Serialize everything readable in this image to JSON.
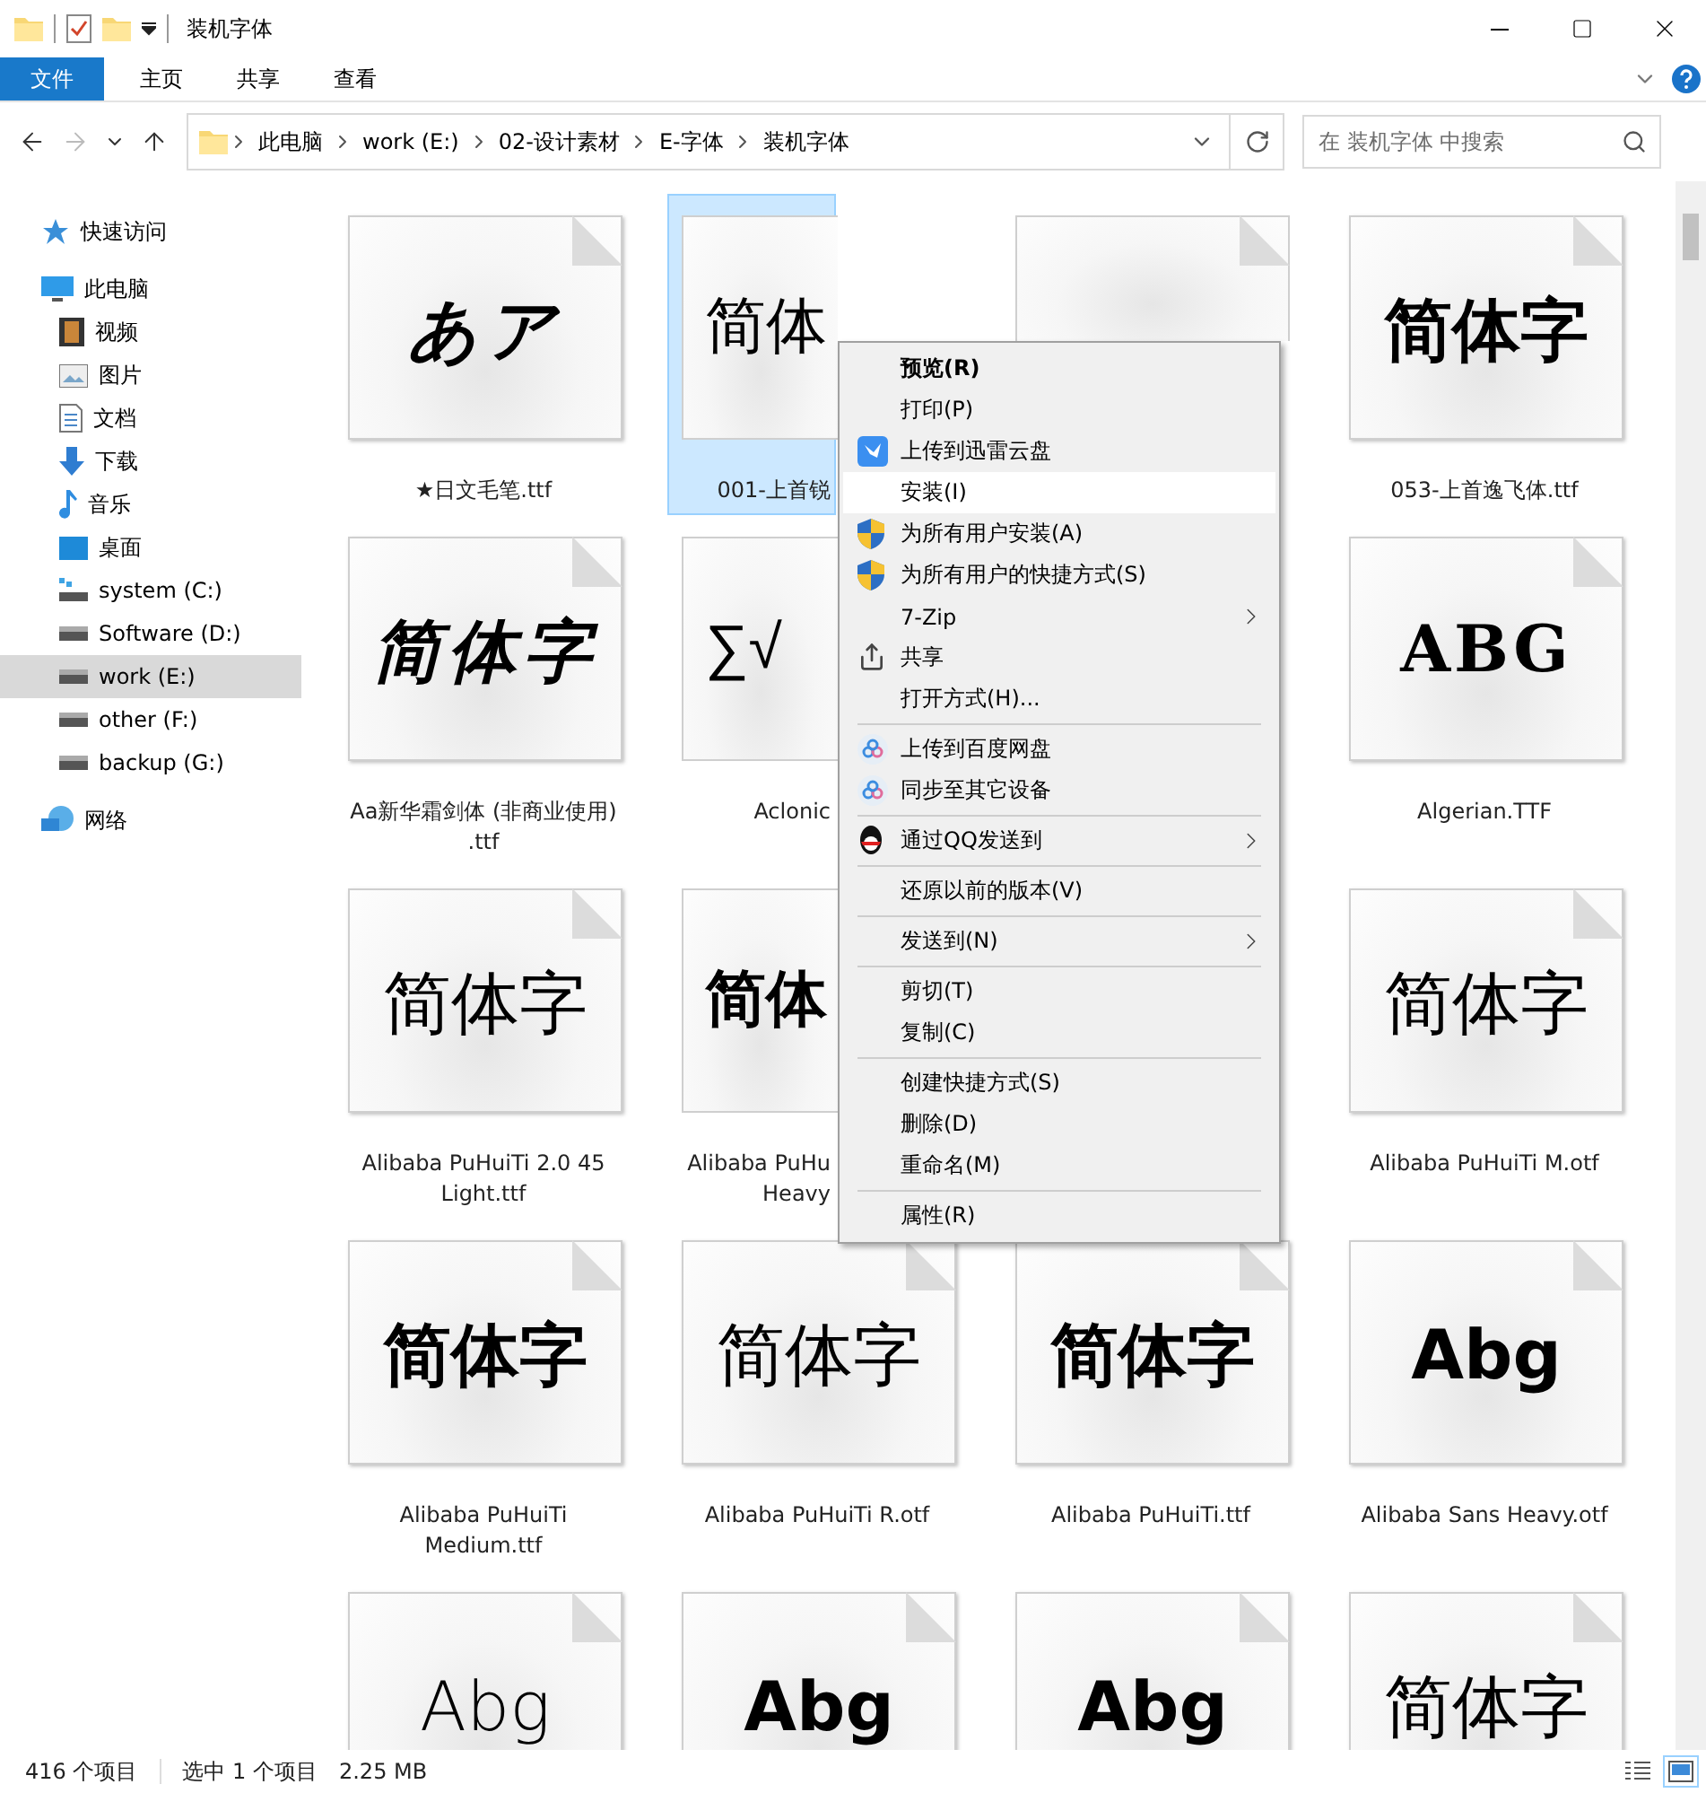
{
  "window": {
    "title": "装机字体"
  },
  "ribbon_tabs": [
    {
      "label": "文件",
      "kind": "file"
    },
    {
      "label": "主页",
      "kind": "tab"
    },
    {
      "label": "共享",
      "kind": "tab"
    },
    {
      "label": "查看",
      "kind": "tab"
    }
  ],
  "address": {
    "breadcrumbs": [
      "此电脑",
      "work (E:)",
      "02-设计素材",
      "E-字体",
      "装机字体"
    ]
  },
  "search": {
    "placeholder": "在 装机字体 中搜索"
  },
  "sidebar": {
    "items": [
      {
        "label": "快速访问",
        "kind": "star",
        "selected": false
      },
      {
        "label": "此电脑",
        "kind": "pc",
        "selected": false,
        "children": [
          {
            "label": "视频",
            "kind": "video",
            "selected": false
          },
          {
            "label": "图片",
            "kind": "pictures",
            "selected": false
          },
          {
            "label": "文档",
            "kind": "documents",
            "selected": false
          },
          {
            "label": "下载",
            "kind": "downloads",
            "selected": false
          },
          {
            "label": "音乐",
            "kind": "music",
            "selected": false
          },
          {
            "label": "桌面",
            "kind": "desktop",
            "selected": false
          },
          {
            "label": "system (C:)",
            "kind": "system-drive",
            "selected": false
          },
          {
            "label": "Software (D:)",
            "kind": "drive",
            "selected": false
          },
          {
            "label": "work (E:)",
            "kind": "drive",
            "selected": true
          },
          {
            "label": "other (F:)",
            "kind": "drive",
            "selected": false
          },
          {
            "label": "backup (G:)",
            "kind": "drive",
            "selected": false
          }
        ]
      },
      {
        "label": "网络",
        "kind": "network",
        "selected": false
      }
    ]
  },
  "files": [
    {
      "name": "★日文毛笔.ttf",
      "preview": "あア",
      "kind": "brush",
      "selected": false
    },
    {
      "name": "001-上首锐",
      "preview": "简体",
      "kind": "thin",
      "selected": true,
      "clipped": true
    },
    {
      "kind": "partial",
      "selected": false
    },
    {
      "name": "053-上首逸飞体.ttf",
      "preview": "简体字",
      "kind": "heavy",
      "selected": false
    },
    {
      "name": "Aa新华霜剑体 (非商业使用)\n.ttf",
      "preview": "简体字",
      "kind": "brush",
      "selected": false
    },
    {
      "name": "Aclonic",
      "preview": "∑√",
      "kind": "thin",
      "selected": false,
      "clipped": true
    },
    {
      "kind": "covered",
      "selected": false
    },
    {
      "name": "Algerian.TTF",
      "preview": "ABG",
      "kind": "decorative",
      "selected": false
    },
    {
      "name": "Alibaba PuHuiTi 2.0 45\nLight.ttf",
      "preview": "简体字",
      "kind": "light",
      "selected": false
    },
    {
      "name": "Alibaba PuHu\nHeavy",
      "preview": "简体",
      "kind": "heavy",
      "selected": false,
      "clipped": true
    },
    {
      "kind": "covered",
      "selected": false
    },
    {
      "name": "Alibaba PuHuiTi M.otf",
      "preview": "简体字",
      "kind": "regular",
      "selected": false
    },
    {
      "name": "Alibaba PuHuiTi\nMedium.ttf",
      "preview": "简体字",
      "kind": "heavy",
      "selected": false
    },
    {
      "name": "Alibaba PuHuiTi R.otf",
      "preview": "简体字",
      "kind": "light",
      "selected": false
    },
    {
      "name": "Alibaba PuHuiTi.ttf",
      "preview": "简体字",
      "kind": "heavy",
      "selected": false
    },
    {
      "name": "Alibaba Sans Heavy.otf",
      "preview": "Abg",
      "kind": "heavy",
      "selected": false
    },
    {
      "preview": "Abg",
      "kind": "thin",
      "selected": false
    },
    {
      "preview": "Abg",
      "kind": "heavy",
      "selected": false
    },
    {
      "preview": "Abg",
      "kind": "heavy",
      "selected": false
    },
    {
      "preview": "简体字",
      "kind": "thin",
      "selected": false
    }
  ],
  "context_menu": {
    "items": [
      {
        "kind": "plain",
        "label": "预览(R)",
        "default": true,
        "selected": false
      },
      {
        "kind": "plain",
        "label": "打印(P)",
        "selected": false
      },
      {
        "kind": "thunder",
        "label": "上传到迅雷云盘",
        "selected": false
      },
      {
        "kind": "plain",
        "label": "安装(I)",
        "selected": true
      },
      {
        "kind": "shield",
        "label": "为所有用户安装(A)",
        "selected": false
      },
      {
        "kind": "shield",
        "label": "为所有用户的快捷方式(S)",
        "selected": false
      },
      {
        "kind": "plain",
        "label": "7-Zip",
        "submenu": true,
        "selected": false
      },
      {
        "kind": "share",
        "label": "共享",
        "selected": false
      },
      {
        "kind": "plain",
        "label": "打开方式(H)...",
        "selected": false
      },
      {
        "kind": "separator"
      },
      {
        "kind": "cloud",
        "label": "上传到百度网盘",
        "selected": false
      },
      {
        "kind": "cloud",
        "label": "同步至其它设备",
        "selected": false
      },
      {
        "kind": "separator"
      },
      {
        "kind": "qq",
        "label": "通过QQ发送到",
        "submenu": true,
        "selected": false
      },
      {
        "kind": "separator"
      },
      {
        "kind": "plain",
        "label": "还原以前的版本(V)",
        "selected": false
      },
      {
        "kind": "separator"
      },
      {
        "kind": "plain",
        "label": "发送到(N)",
        "submenu": true,
        "selected": false
      },
      {
        "kind": "separator"
      },
      {
        "kind": "plain",
        "label": "剪切(T)",
        "selected": false
      },
      {
        "kind": "plain",
        "label": "复制(C)",
        "selected": false
      },
      {
        "kind": "separator"
      },
      {
        "kind": "plain",
        "label": "创建快捷方式(S)",
        "selected": false
      },
      {
        "kind": "plain",
        "label": "删除(D)",
        "selected": false
      },
      {
        "kind": "plain",
        "label": "重命名(M)",
        "selected": false
      },
      {
        "kind": "separator"
      },
      {
        "kind": "plain",
        "label": "属性(R)",
        "selected": false
      }
    ]
  },
  "status_bar": {
    "count": "416 个项目",
    "selection": "选中 1 个项目",
    "size": "2.25 MB",
    "views": [
      {
        "kind": "details",
        "selected": false
      },
      {
        "kind": "large-icons",
        "selected": true
      }
    ]
  }
}
